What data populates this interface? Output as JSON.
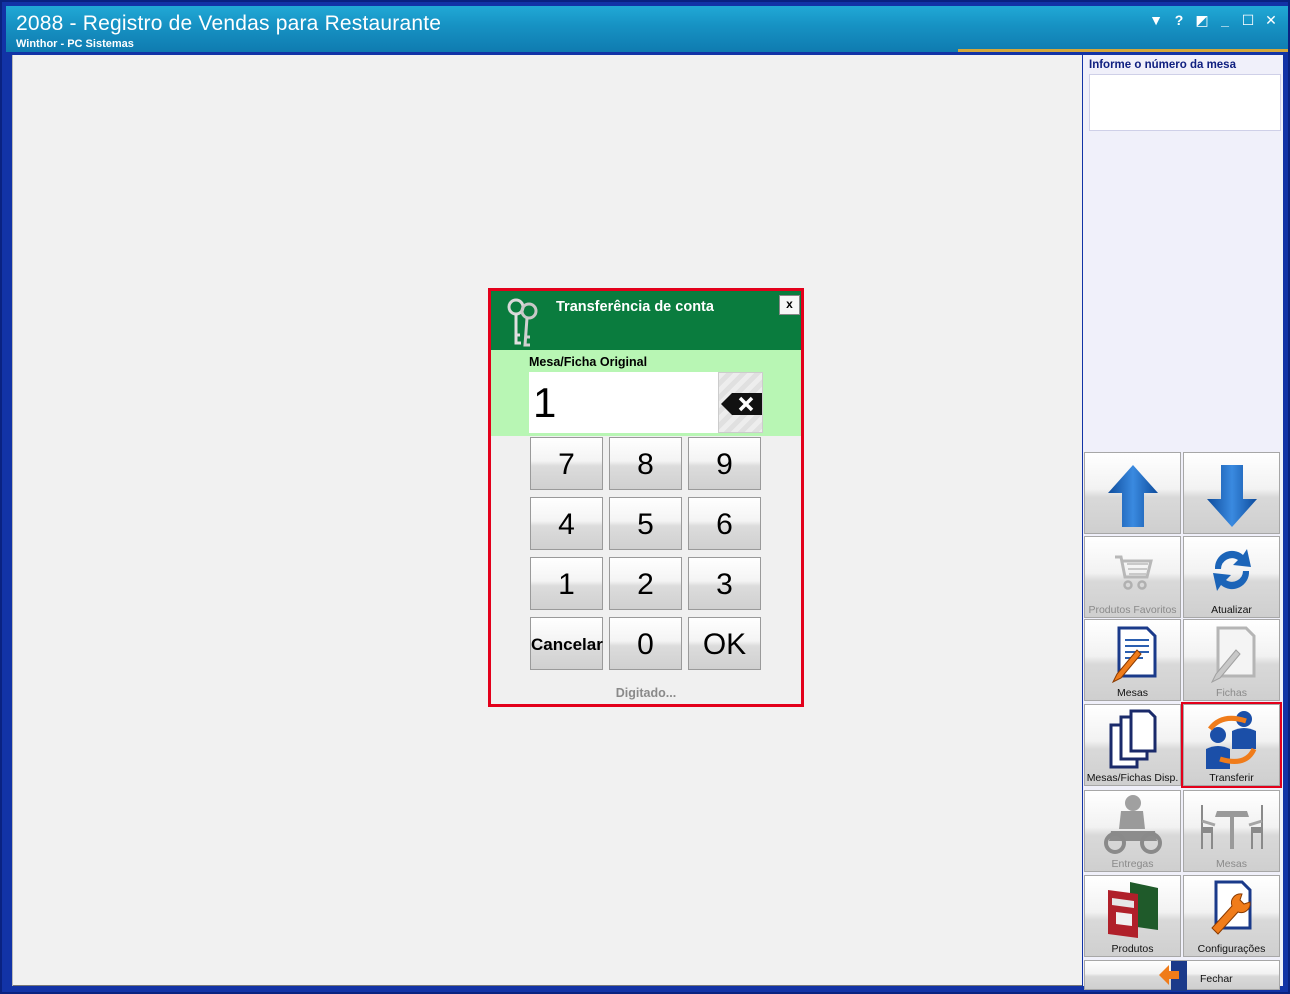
{
  "window": {
    "title": "2088 - Registro de Vendas para Restaurante",
    "subtitle": "Winthor - PC Sistemas",
    "controls": [
      "▼",
      "?",
      "◩",
      "_",
      "☐",
      "✕"
    ]
  },
  "right_panel": {
    "mesa_label": "Informe o número da mesa",
    "mesa_value": "",
    "tiles": [
      {
        "label": "",
        "icon": "arrow-up-icon",
        "disabled": false
      },
      {
        "label": "",
        "icon": "arrow-down-icon",
        "disabled": false
      },
      {
        "label": "Produtos Favoritos",
        "icon": "cart-icon",
        "disabled": true
      },
      {
        "label": "Atualizar",
        "icon": "refresh-icon",
        "disabled": false
      },
      {
        "label": "Mesas",
        "icon": "document-edit-icon",
        "disabled": false
      },
      {
        "label": "Fichas",
        "icon": "document-edit-icon",
        "disabled": true
      },
      {
        "label": "Mesas/Fichas Disp.",
        "icon": "documents-icon",
        "disabled": false
      },
      {
        "label": "Transferir",
        "icon": "transfer-icon",
        "disabled": false
      },
      {
        "label": "Entregas",
        "icon": "delivery-icon",
        "disabled": true
      },
      {
        "label": "Mesas",
        "icon": "table-icon",
        "disabled": true
      },
      {
        "label": "Produtos",
        "icon": "products-icon",
        "disabled": false
      },
      {
        "label": "Configurações",
        "icon": "wrench-icon",
        "disabled": false
      },
      {
        "label": "Fechar",
        "icon": "exit-door-icon",
        "disabled": false
      }
    ]
  },
  "dialog": {
    "title": "Transferência de conta",
    "close_label": "x",
    "field_label": "Mesa/Ficha Original",
    "field_value": "1",
    "keys": [
      "7",
      "8",
      "9",
      "4",
      "5",
      "6",
      "1",
      "2",
      "3",
      "Cancelar",
      "0",
      "OK"
    ],
    "status": "Digitado..."
  },
  "colors": {
    "titlebar": "#1793c4",
    "dialog_header": "#0a7c3e",
    "dialog_field_bg": "#b8f6b4",
    "highlight": "#e3001b",
    "arrow_blue": "#1b64b8"
  }
}
